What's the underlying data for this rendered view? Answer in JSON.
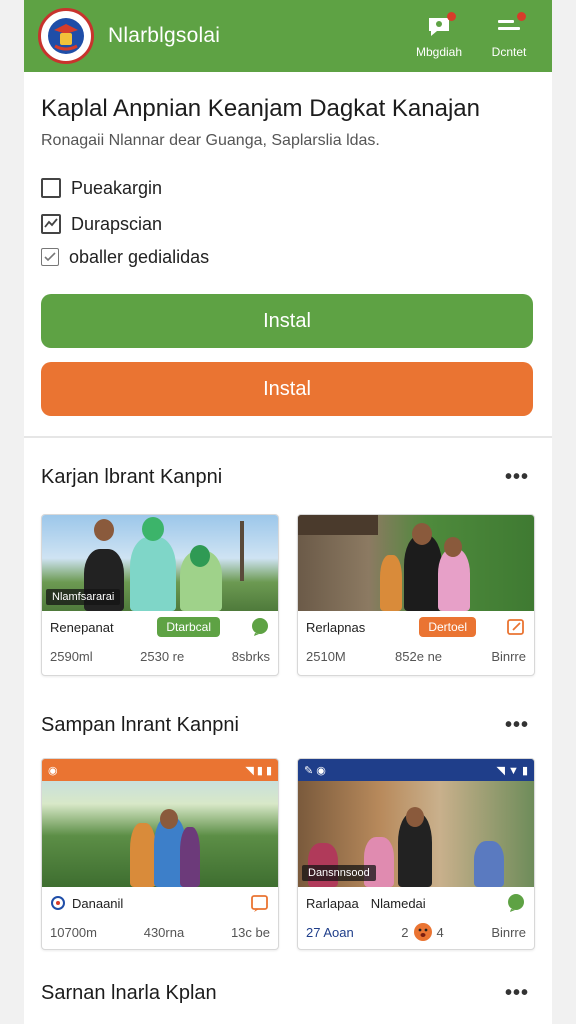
{
  "header": {
    "title": "Nlarblgsolai",
    "actions": [
      {
        "label": "Mbgdiah",
        "icon": "chat-person-icon"
      },
      {
        "label": "Dcntet",
        "icon": "menu-icon"
      }
    ],
    "colors": {
      "bar": "#5ea244",
      "badge": "#d63c2a"
    }
  },
  "intro": {
    "title": "Kaplal Anpnian Keanjam Dagkat Kanajan",
    "subtitle": "Ronagaii Nlannar dear Guanga, Saplarslia ldas.",
    "checks": [
      {
        "label": "Pueakargin",
        "checked": false
      },
      {
        "label": "Durapscian",
        "checked": true
      },
      {
        "label": "oballer gedialidas",
        "checked": true
      }
    ],
    "primary_button": "Instal",
    "secondary_button": "Instal",
    "colors": {
      "green": "#5ea244",
      "orange": "#ea7432"
    }
  },
  "sections": [
    {
      "title": "Karjan lbrant Kanpni",
      "more": "•••",
      "cards": [
        {
          "tag": "Nlamfsararai",
          "name": "Renepanat",
          "pill": "Dtarbcal",
          "pill_color": "#5ea244",
          "stats": [
            "2590ml",
            "2530 re",
            "8sbrks"
          ],
          "icon": "chat-icon"
        },
        {
          "tag": "",
          "name": "Rerlapnas",
          "pill": "Dertoel",
          "pill_color": "#ea7432",
          "stats": [
            "2510M",
            "852e ne",
            "Binrre"
          ],
          "icon": "edit-icon"
        }
      ]
    },
    {
      "title": "Sampan lnrant Kanpni",
      "more": "•••",
      "cards": [
        {
          "tag": "",
          "name": "Danaanil",
          "pill": "",
          "pill_color": "",
          "stats": [
            "10700m",
            "430rna",
            "13c be"
          ],
          "icon": "edit-icon"
        },
        {
          "tag": "Dansnnsood",
          "name": "Rarlapaa",
          "name2": "Nlamedai",
          "pill": "",
          "pill_color": "",
          "stats": [
            "27 Aoan",
            "2",
            "4",
            "Binrre"
          ],
          "icon": "chat-icon"
        }
      ]
    },
    {
      "title": "Sarnan lnarla Kplan",
      "more": "•••"
    }
  ]
}
